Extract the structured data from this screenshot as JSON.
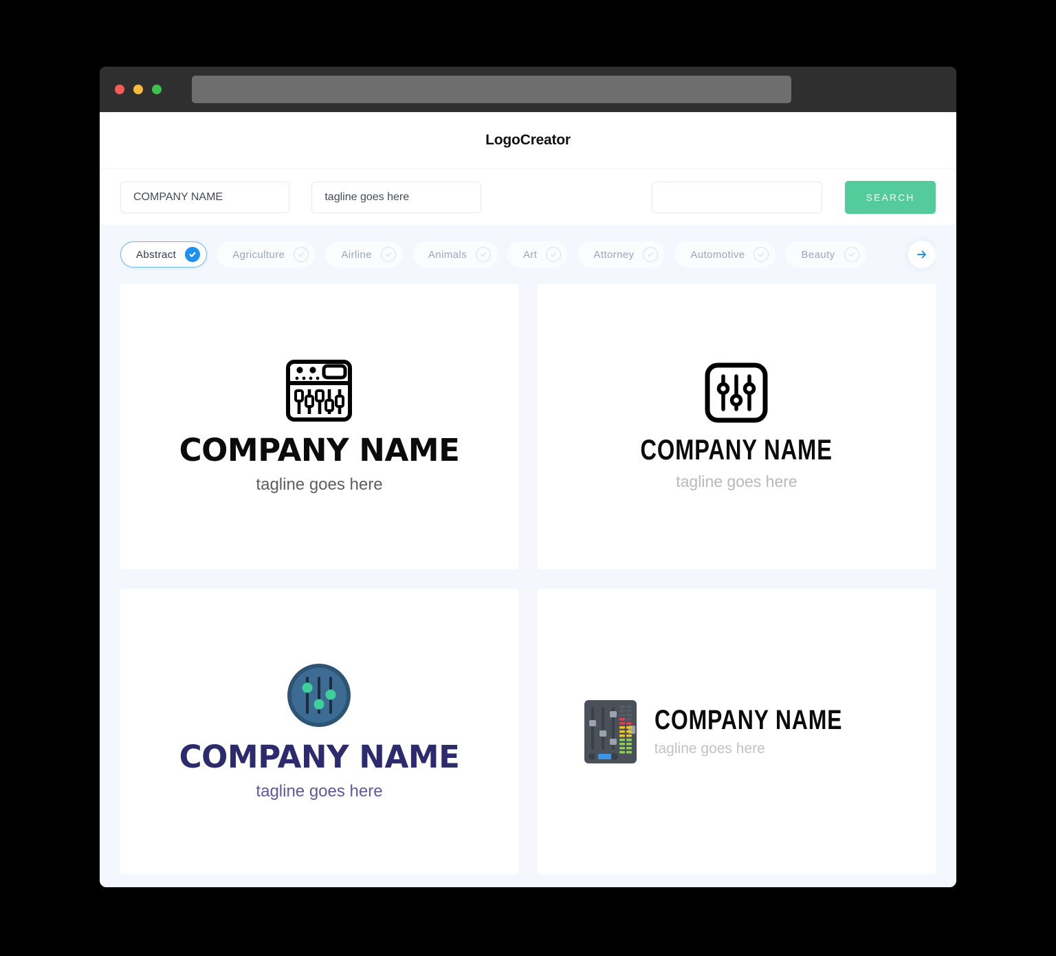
{
  "browser": {
    "traffic_lights": [
      "close-red",
      "minimize-yellow",
      "maximize-green"
    ],
    "url_value": ""
  },
  "header": {
    "brand": "LogoCreator"
  },
  "search": {
    "company_value": "COMPANY NAME",
    "company_placeholder": "COMPANY NAME",
    "tagline_value": "tagline goes here",
    "tagline_placeholder": "tagline goes here",
    "keyword_value": "",
    "keyword_placeholder": "",
    "search_button": "SEARCH",
    "search_button_color": "#53cb9a"
  },
  "categories": {
    "next_arrow_icon": "arrow-right-icon",
    "active_color": "#1e90f0",
    "items": [
      {
        "label": "Abstract",
        "selected": true
      },
      {
        "label": "Agriculture",
        "selected": false
      },
      {
        "label": "Airline",
        "selected": false
      },
      {
        "label": "Animals",
        "selected": false
      },
      {
        "label": "Art",
        "selected": false
      },
      {
        "label": "Attorney",
        "selected": false
      },
      {
        "label": "Automotive",
        "selected": false
      },
      {
        "label": "Beauty",
        "selected": false
      }
    ]
  },
  "results": {
    "cards": [
      {
        "icon": "mixer-console-outline-icon",
        "company": "COMPANY NAME",
        "tagline": "tagline goes here",
        "text_color": "#0b0b0b",
        "tagline_color": "#5e5e5e"
      },
      {
        "icon": "equalizer-rounded-square-outline-icon",
        "company": "COMPANY NAME",
        "tagline": "tagline goes here",
        "text_color": "#0b0b0b",
        "tagline_color": "#b9b9b9"
      },
      {
        "icon": "equalizer-circle-badge-icon",
        "company": "COMPANY NAME",
        "tagline": "tagline goes here",
        "text_color": "#2d2a6e",
        "tagline_color": "#5b5a9a",
        "icon_colors": {
          "outer_circle": "#2d5473",
          "inner_circle": "#3c6c94",
          "sliders": "#1d2b3e",
          "dots": "#3fcf9a"
        }
      },
      {
        "icon": "mixing-board-flat-icon",
        "company": "COMPANY NAME",
        "tagline": "tagline goes here",
        "text_color": "#0b0b0b",
        "tagline_color": "#c2c2c2",
        "icon_colors": {
          "panel": "#4b5159",
          "track": "#3a4049",
          "knob": "#9aa3ad",
          "led_red": "#e0404a",
          "led_yellow": "#f2c12e",
          "led_green": "#8cd05a",
          "led_off": "#555c66",
          "slider_bar": "#3d95e8"
        }
      }
    ]
  }
}
